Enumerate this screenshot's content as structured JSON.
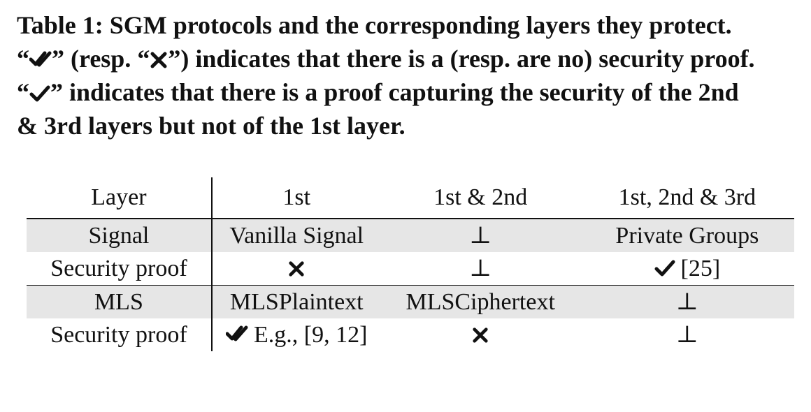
{
  "caption": {
    "line1": "Table 1: SGM protocols and the corresponding layers they protect.",
    "line2_a": "“",
    "line2_b": "” (resp. “",
    "line2_c": "”) indicates that there is a (resp. are no) security proof.",
    "line3_a": "“",
    "line3_b": "” indicates that there is a proof capturing the security of the 2nd",
    "line4": "& 3rd layers but not of the 1st layer.",
    "icons": [
      "double-check-icon",
      "cross-icon",
      "check-icon"
    ]
  },
  "table": {
    "headers": [
      "Layer",
      "1st",
      "1st & 2nd",
      "1st, 2nd & 3rd"
    ],
    "rows": [
      {
        "cells": [
          "Signal",
          "Vanilla Signal",
          "⊥",
          "Private Groups"
        ]
      },
      {
        "cells": [
          "Security proof",
          "",
          "⊥",
          "[25]"
        ],
        "icons": [
          "",
          "cross-icon",
          "",
          "check-icon"
        ]
      },
      {
        "cells": [
          "MLS",
          "MLSPlaintext",
          "MLSCiphertext",
          "⊥"
        ]
      },
      {
        "cells": [
          "Security proof",
          "E.g., [9, 12]",
          "",
          "⊥"
        ],
        "icons": [
          "",
          "double-check-icon",
          "cross-icon",
          ""
        ]
      }
    ]
  }
}
